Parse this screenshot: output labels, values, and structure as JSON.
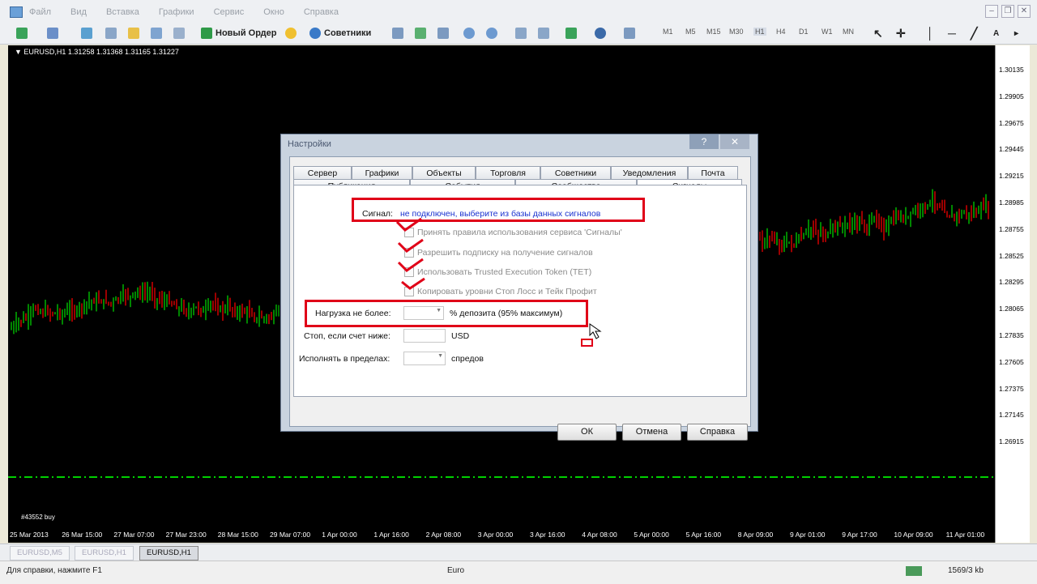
{
  "menu": {
    "items": [
      "Файл",
      "Вид",
      "Вставка",
      "Графики",
      "Сервис",
      "Окно",
      "Справка"
    ]
  },
  "toolbar": {
    "new_order": "Новый Ордер",
    "experts": "Советники",
    "timeframes": [
      "M1",
      "M5",
      "M15",
      "M30",
      "H1",
      "H4",
      "D1",
      "W1",
      "MN"
    ]
  },
  "chart": {
    "info": "▼ EURUSD,H1  1.31258 1.31368 1.31165 1.31227",
    "order_label": "#43552 buy",
    "prices": [
      "1.30135",
      "1.29905",
      "1.29675",
      "1.29445",
      "1.29215",
      "1.28985",
      "1.28755",
      "1.28525",
      "1.28295",
      "1.28065",
      "1.27835",
      "1.27605",
      "1.27375",
      "1.27145",
      "1.26915"
    ],
    "times": [
      "25 Mar 2013",
      "26 Mar 15:00",
      "27 Mar 07:00",
      "27 Mar 23:00",
      "28 Mar 15:00",
      "29 Mar 07:00",
      "1 Apr 00:00",
      "1 Apr 16:00",
      "2 Apr 08:00",
      "3 Apr 00:00",
      "3 Apr 16:00",
      "4 Apr 08:00",
      "5 Apr 00:00",
      "5 Apr 16:00",
      "8 Apr 09:00",
      "9 Apr 01:00",
      "9 Apr 17:00",
      "10 Apr 09:00",
      "11 Apr 01:00"
    ],
    "colors": {
      "bull": "#00c000",
      "bear": "#e00000",
      "order_line": "#00d000"
    }
  },
  "chart_tabs": [
    "EURUSD,M5",
    "EURUSD,H1",
    "EURUSD,H1"
  ],
  "status": {
    "help": "Для справки, нажмите F1",
    "profile": "Euro",
    "traffic": "1569/3 kb"
  },
  "dialog": {
    "title": "Настройки",
    "help_btn": "?",
    "close_btn": "✕",
    "tabs_row1": [
      "Сервер",
      "Графики",
      "Объекты",
      "Торговля",
      "Советники",
      "Уведомления",
      "Почта"
    ],
    "tabs_row2": [
      "Публикация",
      "События",
      "Сообщество",
      "Сигналы"
    ],
    "signal_label": "Сигнал:",
    "signal_value": "не подключен, выберите из базы данных сигналов",
    "options": [
      "Принять правила использования сервиса 'Сигналы'",
      "Разрешить подписку на получение сигналов",
      "Использовать Trusted Execution Token (TET)",
      "Копировать уровни Стоп Лосс и Тейк Профит"
    ],
    "load_label": "Нагрузка не более:",
    "load_suffix": "% депозита (95% максимум)",
    "stop_label": "Стоп, если счет ниже:",
    "stop_suffix": "USD",
    "exec_label": "Исполнять в пределах:",
    "exec_suffix": "спредов",
    "ok": "ОК",
    "cancel": "Отмена",
    "help": "Справка"
  }
}
